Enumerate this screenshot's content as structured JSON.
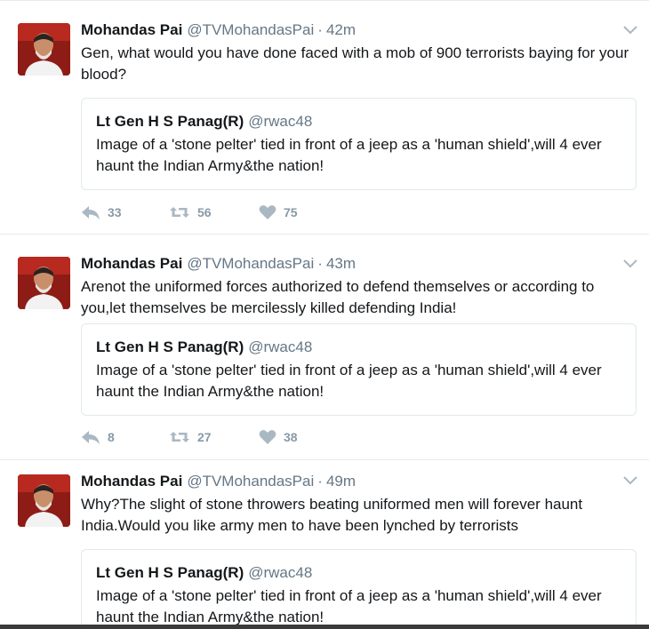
{
  "tweets": [
    {
      "name": "Mohandas Pai",
      "handle": "@TVMohandasPai",
      "time": "42m",
      "text": "Gen, what would you have done faced with a mob of 900 terrorists baying for your blood?",
      "quote": {
        "name": "Lt Gen H S Panag(R)",
        "handle": "@rwac48",
        "text": "Image of a 'stone pelter' tied in front of a jeep as a 'human shield',will 4 ever haunt the Indian Army&the nation!"
      },
      "replies": "33",
      "retweets": "56",
      "likes": "75"
    },
    {
      "name": "Mohandas Pai",
      "handle": "@TVMohandasPai",
      "time": "43m",
      "text": "Arenot the uniformed forces authorized to defend themselves or according to you,let themselves be mercilessly killed defending India!",
      "quote": {
        "name": "Lt Gen H S Panag(R)",
        "handle": "@rwac48",
        "text": "Image of a 'stone pelter' tied in front of a jeep as a 'human shield',will 4 ever haunt the Indian Army&the nation!"
      },
      "replies": "8",
      "retweets": "27",
      "likes": "38"
    },
    {
      "name": "Mohandas Pai",
      "handle": "@TVMohandasPai",
      "time": "49m",
      "text": "Why?The slight of stone throwers beating uniformed men will forever haunt India.Would you like army men to have been lynched by terrorists",
      "quote": {
        "name": "Lt Gen H S Panag(R)",
        "handle": "@rwac48",
        "text": "Image of a 'stone pelter' tied in front of a jeep as a 'human shield',will 4 ever haunt the Indian Army&the nation!"
      }
    }
  ],
  "separator": "·",
  "icons": {
    "reply": "reply-icon",
    "retweet": "retweet-icon",
    "like": "heart-icon",
    "caret": "chevron-down-icon"
  },
  "colors": {
    "secondary_text": "#657786",
    "action_icon": "#aab8c2",
    "border": "#e1e8ed"
  }
}
